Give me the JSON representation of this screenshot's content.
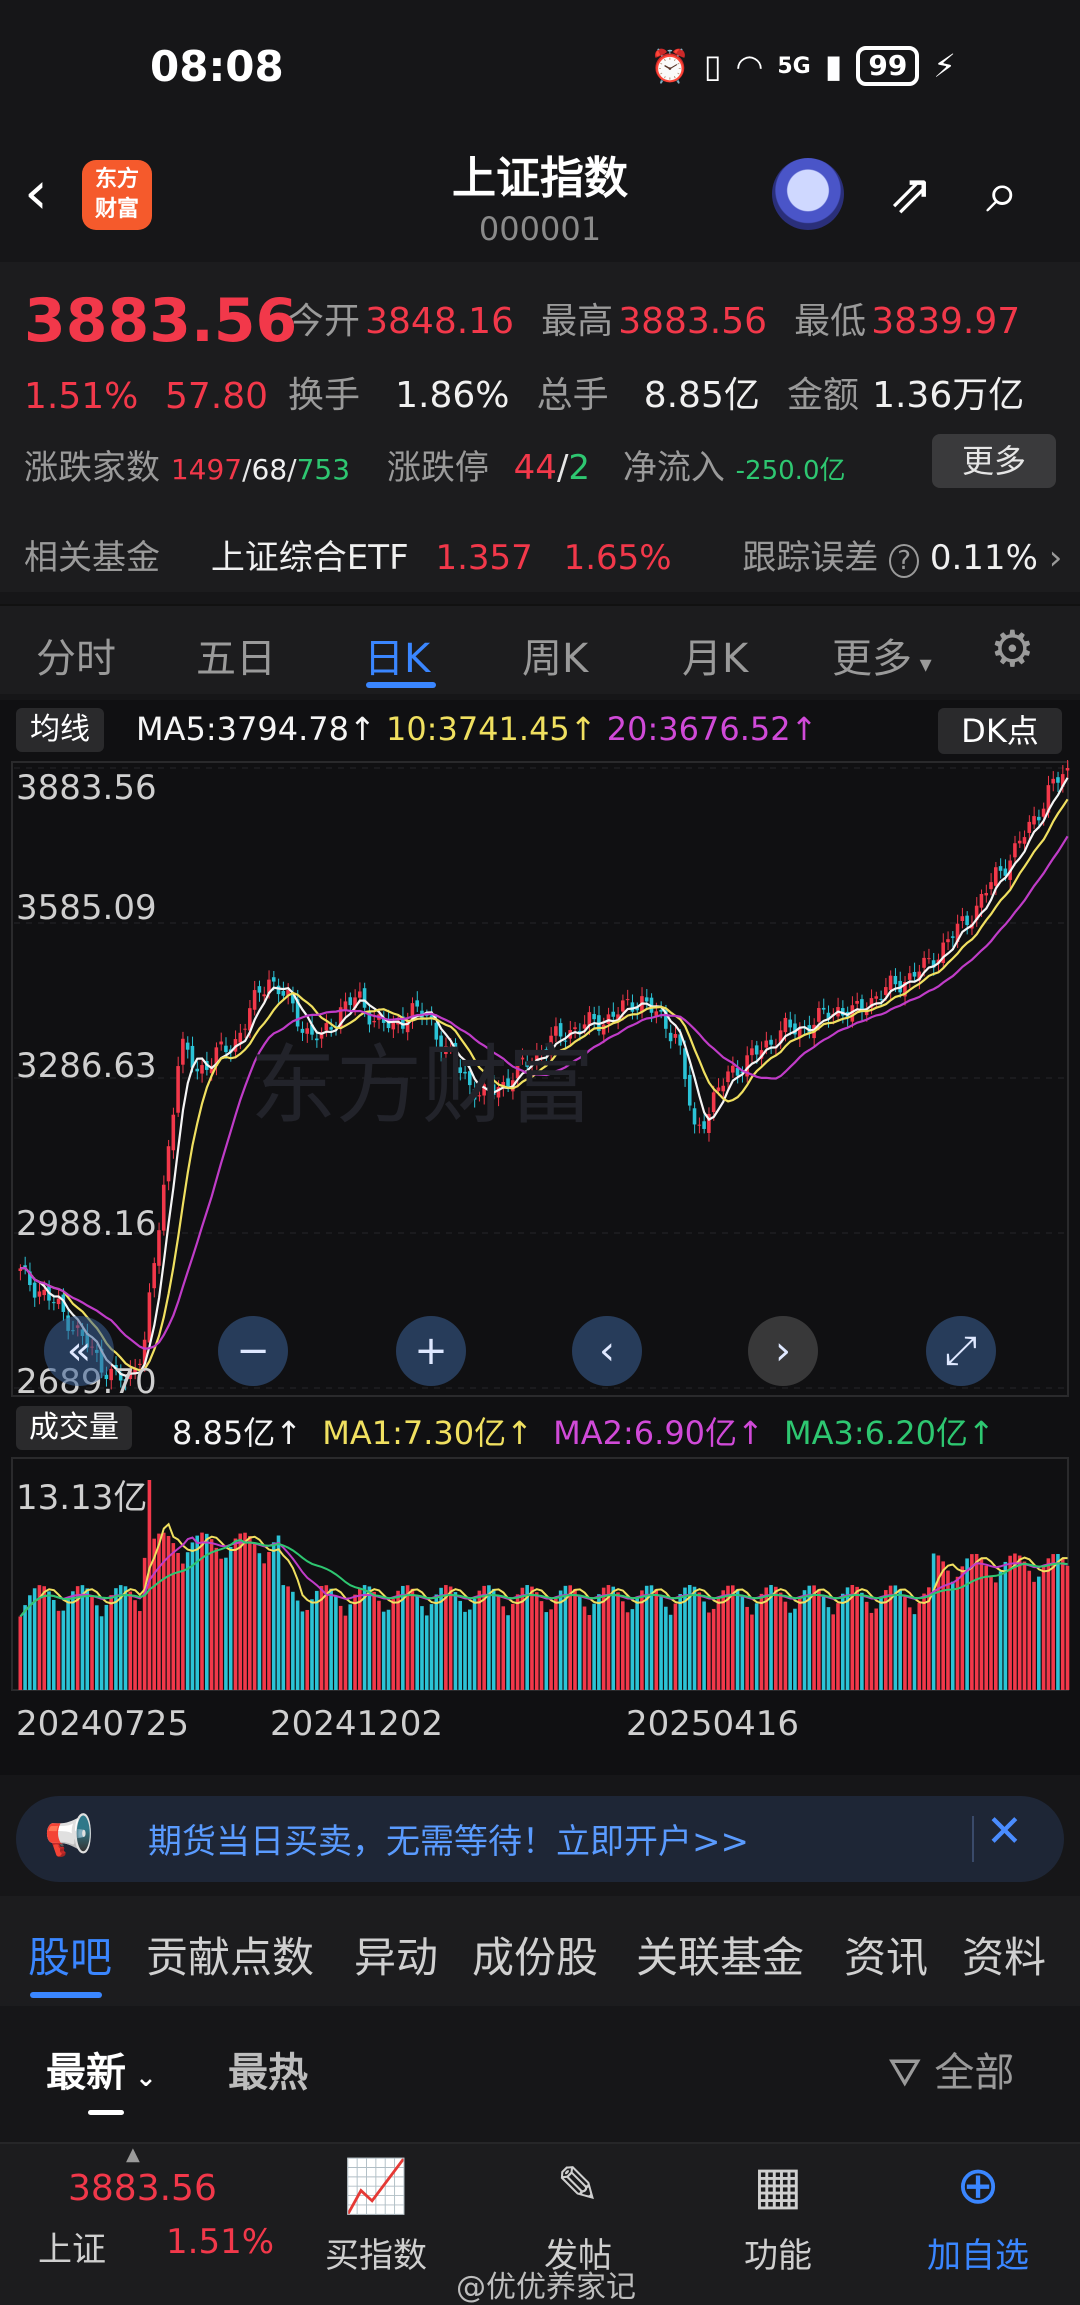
{
  "status": {
    "time": "08:08",
    "network": "5G",
    "battery": "99"
  },
  "header": {
    "title": "上证指数",
    "code": "000001",
    "logo": "东方\n财富"
  },
  "quote": {
    "price": "3883.56",
    "pct": "1.51%",
    "change": "57.80",
    "open_label": "今开",
    "open": "3848.16",
    "high_label": "最高",
    "high": "3883.56",
    "low_label": "最低",
    "low": "3839.97",
    "turnover_label": "换手",
    "turnover": "1.86%",
    "volume_label": "总手",
    "volume": "8.85亿",
    "amount_label": "金额",
    "amount": "1.36万亿",
    "breadth_label": "涨跌家数",
    "up": "1497",
    "flat": "68",
    "down": "753",
    "limit_label": "涨跌停",
    "limit_up": "44",
    "limit_down": "2",
    "netflow_label": "净流入",
    "netflow": "-250.0亿",
    "more": "更多"
  },
  "fund": {
    "label": "相关基金",
    "name": "上证综合ETF",
    "price": "1.357",
    "pct": "1.65%",
    "tracking_label": "跟踪误差",
    "tracking": "0.11%"
  },
  "ktabs": [
    "分时",
    "五日",
    "日K",
    "周K",
    "月K",
    "更多"
  ],
  "ma": {
    "box": "均线",
    "ma5": "MA5:3794.78↑",
    "ma10": "10:3741.45↑",
    "ma20": "20:3676.52↑",
    "dk": "DK点"
  },
  "yaxis": [
    "3883.56",
    "3585.09",
    "3286.63",
    "2988.16",
    "2689.70"
  ],
  "vol": {
    "box": "成交量",
    "value": "8.85亿↑",
    "ma1": "MA1:7.30亿↑",
    "ma2": "MA2:6.90亿↑",
    "ma3": "MA3:6.20亿↑",
    "max": "13.13亿"
  },
  "dates": [
    "20240725",
    "20241202",
    "20250416"
  ],
  "colors": {
    "up": "#f2384a",
    "down": "#2bc3d6",
    "ma5": "#f5f5f5",
    "ma10": "#f0e060",
    "ma20": "#c03cc8",
    "accent": "#3a86ff"
  },
  "chart_data": {
    "type": "line",
    "title": "",
    "xlabel": "",
    "ylabel": "",
    "ylim": [
      2689.7,
      3883.56
    ],
    "x": [
      "20240725",
      "20241202",
      "20250416"
    ],
    "series": [
      {
        "name": "MA5",
        "last": 3794.78
      },
      {
        "name": "10",
        "last": 3741.45
      },
      {
        "name": "20",
        "last": 3676.52
      }
    ],
    "close_path": [
      2910,
      2880,
      2850,
      2810,
      2760,
      2720,
      2700,
      2780,
      3050,
      3350,
      3300,
      3330,
      3350,
      3420,
      3480,
      3440,
      3380,
      3360,
      3420,
      3440,
      3400,
      3380,
      3420,
      3400,
      3340,
      3290,
      3250,
      3270,
      3300,
      3330,
      3360,
      3380,
      3390,
      3400,
      3420,
      3440,
      3400,
      3370,
      3180,
      3240,
      3300,
      3320,
      3350,
      3380,
      3380,
      3400,
      3420,
      3410,
      3440,
      3460,
      3480,
      3500,
      3540,
      3580,
      3620,
      3680,
      3720,
      3780,
      3840,
      3883.56
    ],
    "volume_max": "13.13亿"
  },
  "banner": {
    "text": "期货当日买卖，无需等待！立即开户>>"
  },
  "subtabs": [
    "股吧",
    "贡献点数",
    "异动",
    "成份股",
    "关联基金",
    "资讯",
    "资料"
  ],
  "sort": {
    "latest": "最新",
    "hot": "最热",
    "filter": "全部"
  },
  "bottom": {
    "price": "3883.56",
    "name": "上证",
    "pct": "1.51%",
    "buy": "买指数",
    "post": "发帖",
    "func": "功能",
    "add": "加自选"
  },
  "watermark": "@优优养家记"
}
